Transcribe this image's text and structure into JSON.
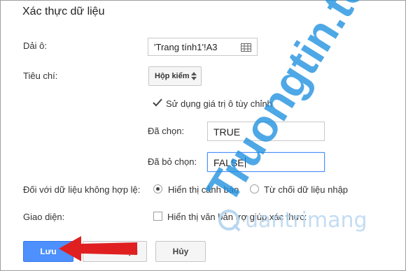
{
  "dialog": {
    "title": "Xác thực dữ liệu",
    "range_label": "Dải ô:",
    "range_value": "'Trang tính1'!A3",
    "criteria_label": "Tiêu chí:",
    "criteria_value": "Hộp kiểm",
    "custom_values_label": "Sử dụng giá trị ô tùy chỉnh",
    "custom_values_checked": true,
    "checked_label": "Đã chọn:",
    "checked_value": "TRUE",
    "unchecked_label": "Đã bỏ chọn:",
    "unchecked_value": "FALSE",
    "invalid_label": "Đối với dữ liệu không hợp lệ:",
    "invalid_options": [
      "Hiển thị cảnh báo",
      "Từ chối dữ liệu nhập"
    ],
    "invalid_selected": "Hiển thị cảnh báo",
    "appearance_label": "Giao diện:",
    "help_text_label": "Hiển thị văn bản trợ giúp xác thực:",
    "help_text_checked": false
  },
  "buttons": {
    "save": "Lưu",
    "remove_partial": "rực",
    "cancel": "Hủy"
  },
  "watermark": {
    "site": "Truongtin.top",
    "logo_text": "uantrimang"
  },
  "colors": {
    "primary_button": "#4d90fe",
    "arrow": "#e02020",
    "watermark": "#1e90e0"
  }
}
